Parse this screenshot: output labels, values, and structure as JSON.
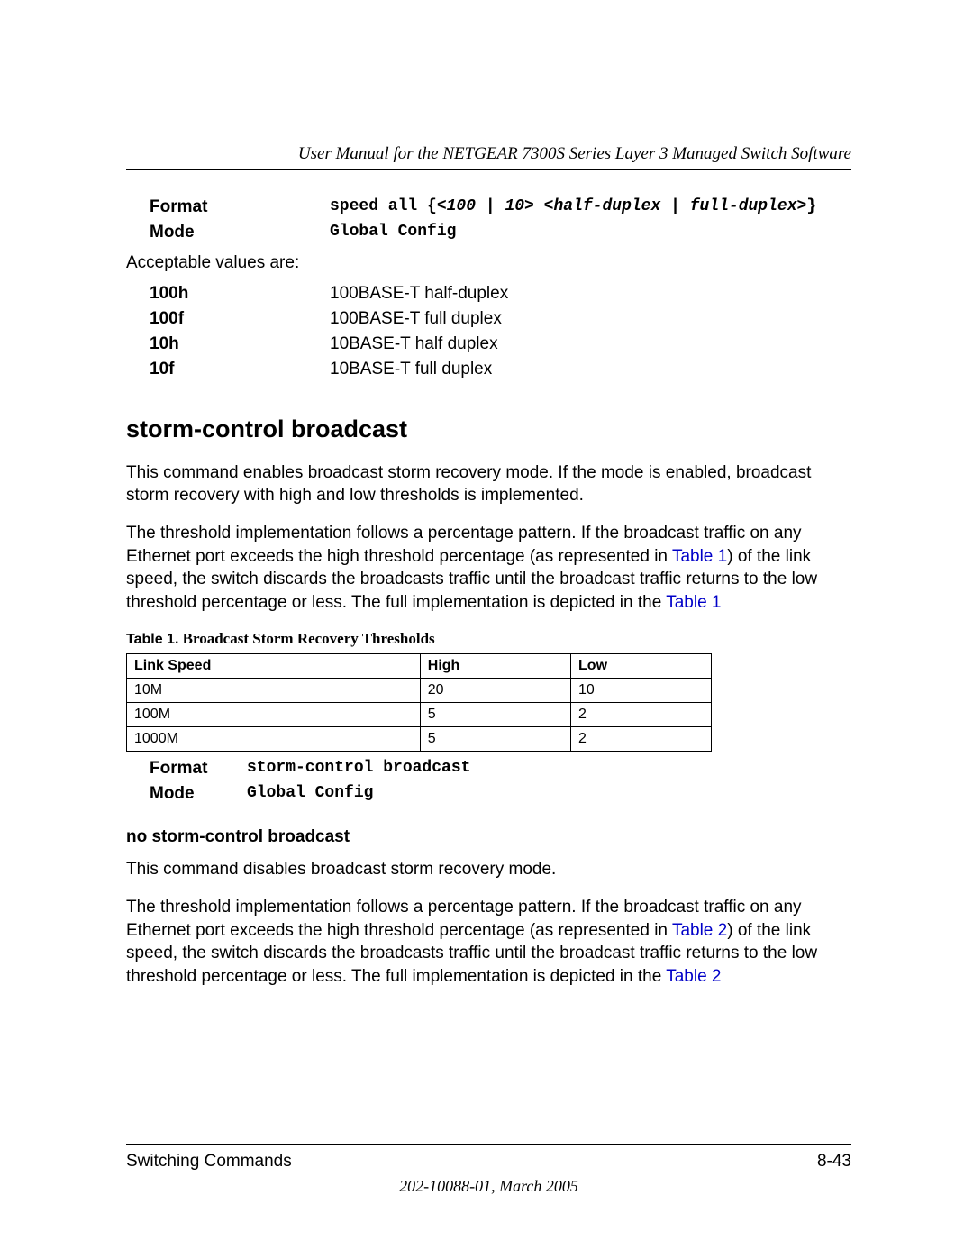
{
  "runningHeader": "User Manual for the NETGEAR 7300S Series Layer 3 Managed Switch Software",
  "top": {
    "formatLabel": "Format",
    "formatValue": "speed all {<100 | 10> <half-duplex | full-duplex>}",
    "modeLabel": "Mode",
    "modeValue": "Global Config",
    "acceptableIntro": "Acceptable values are:",
    "vals": [
      {
        "k": "100h",
        "v": "100BASE-T half-duplex"
      },
      {
        "k": "100f",
        "v": "100BASE-T full duplex"
      },
      {
        "k": "10h",
        "v": "10BASE-T half duplex"
      },
      {
        "k": "10f",
        "v": "10BASE-T full duplex"
      }
    ]
  },
  "section": {
    "heading": "storm-control broadcast",
    "para1_a": "This command enables broadcast storm recovery mode. If the mode is enabled, broadcast storm recovery with high and low thresholds is implemented.",
    "para2_a": "The threshold implementation follows a percentage pattern. If the broadcast traffic on any Ethernet port exceeds the high threshold percentage (as represented in ",
    "para2_link1": "Table 1",
    "para2_b": ") of the link speed, the switch discards the broadcasts traffic until the broadcast traffic returns to the low threshold percentage or less. The full implementation is depicted in the ",
    "para2_link2": "Table 1",
    "tableCaptionLead": "Table 1.",
    "tableCaptionTitle": " Broadcast Storm Recovery Thresholds",
    "table": {
      "headers": [
        "Link Speed",
        "High",
        "Low"
      ],
      "rows": [
        [
          "10M",
          "20",
          "10"
        ],
        [
          "100M",
          "5",
          "2"
        ],
        [
          "1000M",
          "5",
          "2"
        ]
      ]
    },
    "formatLabel": "Format",
    "formatValue": "storm-control broadcast",
    "modeLabel": "Mode",
    "modeValue": "Global Config"
  },
  "nosection": {
    "heading": "no storm-control broadcast",
    "para1": "This command disables broadcast storm recovery mode.",
    "para2_a": "The threshold implementation follows a percentage pattern. If the broadcast traffic on any Ethernet port exceeds the high threshold percentage (as represented in ",
    "para2_link1": "Table 2",
    "para2_b": ") of the link speed, the switch discards the broadcasts traffic until the broadcast traffic returns to the low threshold percentage or less. The full implementation is depicted in the ",
    "para2_link2": "Table 2"
  },
  "footer": {
    "left": "Switching Commands",
    "right": "8-43",
    "center": "202-10088-01, March 2005"
  }
}
